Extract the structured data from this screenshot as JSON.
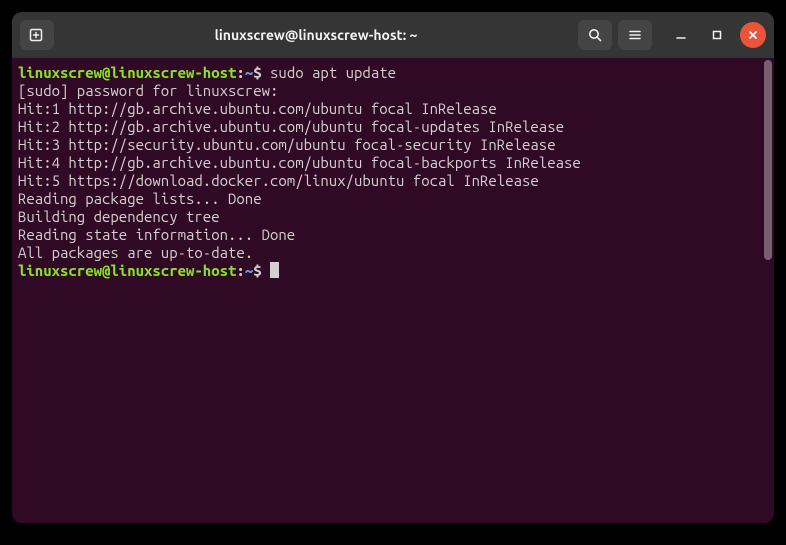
{
  "titlebar": {
    "title": "linuxscrew@linuxscrew-host: ~"
  },
  "prompt": {
    "user_host": "linuxscrew@linuxscrew-host",
    "colon": ":",
    "path": "~",
    "dollar": "$"
  },
  "command": "sudo apt update",
  "output": {
    "l1": "[sudo] password for linuxscrew: ",
    "l2": "Hit:1 http://gb.archive.ubuntu.com/ubuntu focal InRelease",
    "l3": "Hit:2 http://gb.archive.ubuntu.com/ubuntu focal-updates InRelease",
    "l4": "Hit:3 http://security.ubuntu.com/ubuntu focal-security InRelease",
    "l5": "Hit:4 http://gb.archive.ubuntu.com/ubuntu focal-backports InRelease",
    "l6": "Hit:5 https://download.docker.com/linux/ubuntu focal InRelease",
    "l7": "Reading package lists... Done",
    "l8": "Building dependency tree       ",
    "l9": "Reading state information... Done",
    "l10": "All packages are up-to-date."
  }
}
